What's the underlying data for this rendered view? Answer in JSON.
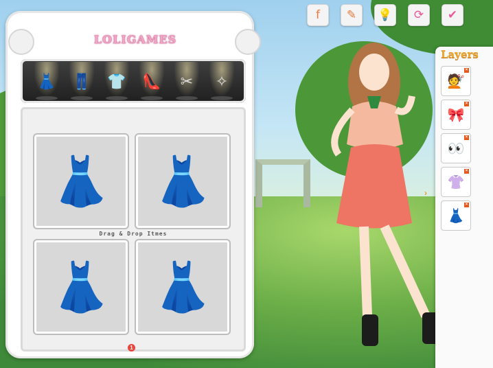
{
  "logo": "LOLIGAMES",
  "toolbar": [
    {
      "name": "facebook-button",
      "glyph": "f",
      "color": "#e9793f"
    },
    {
      "name": "makeup-button",
      "glyph": "✎",
      "color": "#e9793f"
    },
    {
      "name": "hint-button",
      "glyph": "💡",
      "color": "#d97bd0"
    },
    {
      "name": "reset-button",
      "glyph": "⟳",
      "color": "#e85a9c"
    },
    {
      "name": "done-button",
      "glyph": "✔",
      "color": "#e85a9c"
    }
  ],
  "categories": [
    {
      "name": "category-dresses",
      "glyph": "👗"
    },
    {
      "name": "category-pants",
      "glyph": "👖"
    },
    {
      "name": "category-tops",
      "glyph": "👕"
    },
    {
      "name": "category-shoes",
      "glyph": "👠"
    },
    {
      "name": "category-hairstyles",
      "glyph": "✂"
    },
    {
      "name": "category-accessories",
      "glyph": "✧"
    }
  ],
  "items": [
    {
      "name": "item-long-skirt-dress",
      "glyph": "👗",
      "color": "#e8927a"
    },
    {
      "name": "item-striped-bow-dress",
      "glyph": "👗",
      "color": "#b9d8cf"
    },
    {
      "name": "item-olive-collar-dress",
      "glyph": "👗",
      "color": "#5c6a3a"
    },
    {
      "name": "item-blue-shirt-dress",
      "glyph": "👗",
      "color": "#b7cde6"
    }
  ],
  "caption": "Drag & Drop Itmes",
  "page_number": "1",
  "layers": {
    "title": "Layers",
    "items": [
      {
        "name": "layer-hair",
        "glyph": "💇"
      },
      {
        "name": "layer-scarf",
        "glyph": "🎀"
      },
      {
        "name": "layer-eyes",
        "glyph": "👀"
      },
      {
        "name": "layer-top",
        "glyph": "👚"
      },
      {
        "name": "layer-skirt",
        "glyph": "👗"
      }
    ]
  }
}
